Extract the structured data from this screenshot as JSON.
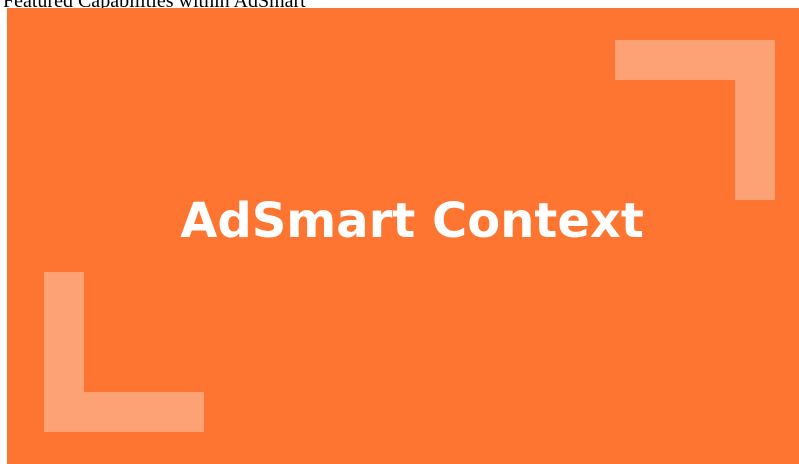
{
  "caption": "Featured Capabilities within AdSmart",
  "banner": {
    "title": "AdSmart Context",
    "background_color": "#FD7530",
    "bracket_color": "#FDA274",
    "title_color": "#FFFFFF"
  }
}
